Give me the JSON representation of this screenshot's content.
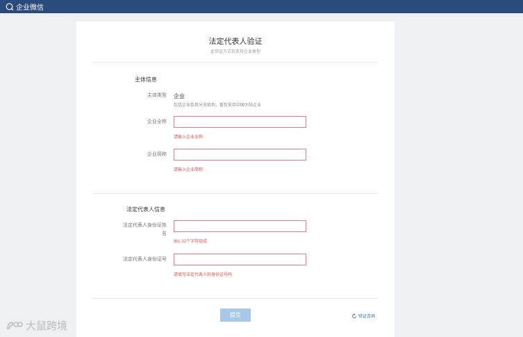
{
  "app": {
    "name": "企业微信"
  },
  "page": {
    "title": "法定代表人验证",
    "subtitle": "此验证方式仅支持企业类型"
  },
  "sections": {
    "entity": {
      "title": "主体信息",
      "type_label": "主体类型",
      "type_value": "企业",
      "type_hint": "包括企业及其分支机构，暂仅支持中国大陆企业",
      "full_name_label": "企业全称",
      "full_name_value": "",
      "full_name_error": "请输入企业全称",
      "short_name_label": "企业简称",
      "short_name_value": "",
      "short_name_error": "请输入企业简称"
    },
    "legal": {
      "title": "法定代表人信息",
      "name_label_line1": "法定代表人身份证姓",
      "name_label_line2": "名",
      "name_value": "",
      "name_error": "由1-32个字符组成",
      "id_label": "法定代表人身份证号",
      "id_value": "",
      "id_error": "请填写法定代表人的身份证号码"
    }
  },
  "actions": {
    "submit_label": "提交",
    "help_label": "验证咨询"
  },
  "watermark": {
    "text": "大鼠跨境"
  }
}
